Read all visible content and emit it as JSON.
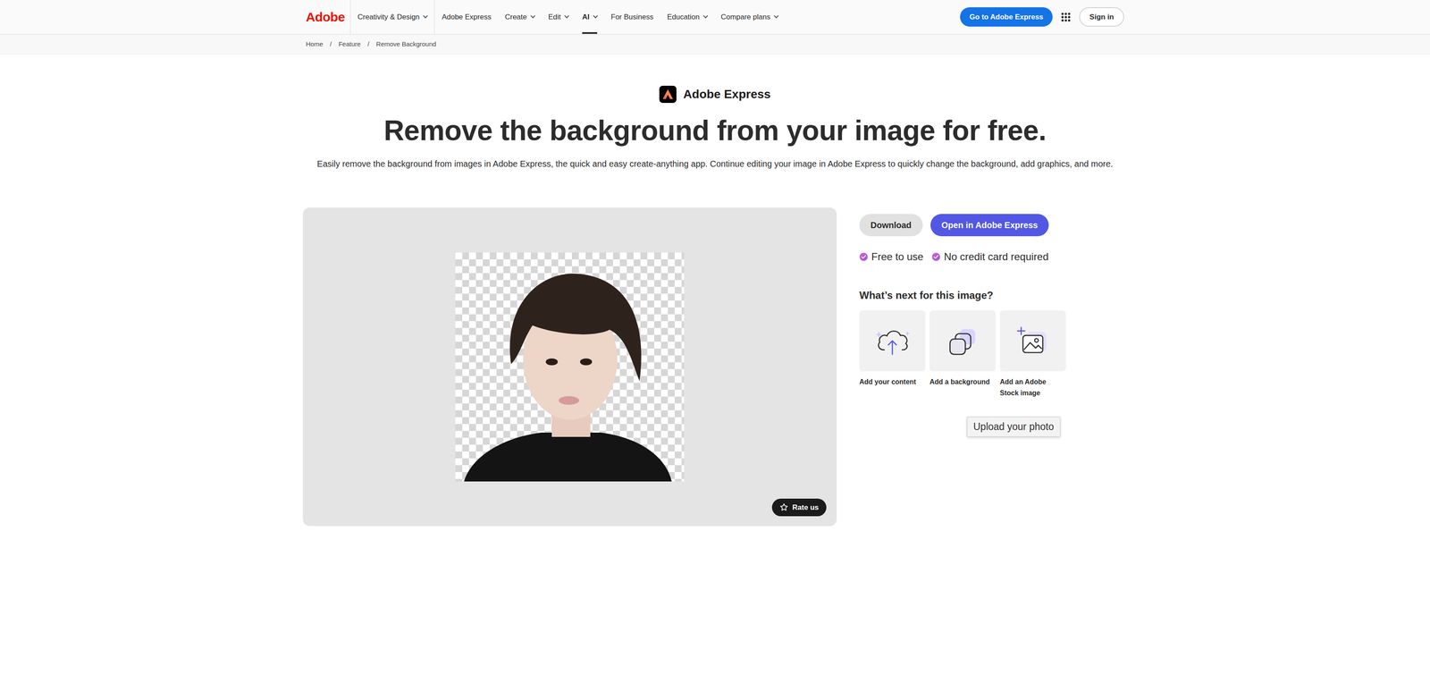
{
  "nav": {
    "logo": "Adobe",
    "items": [
      {
        "label": "Creativity & Design",
        "dropdown": true,
        "selected": false
      },
      {
        "label": "Adobe Express",
        "dropdown": false,
        "selected": false
      },
      {
        "label": "Create",
        "dropdown": true,
        "selected": false
      },
      {
        "label": "Edit",
        "dropdown": true,
        "selected": false
      },
      {
        "label": "AI",
        "dropdown": true,
        "selected": true
      },
      {
        "label": "For Business",
        "dropdown": false,
        "selected": false
      },
      {
        "label": "Education",
        "dropdown": true,
        "selected": false
      },
      {
        "label": "Compare plans",
        "dropdown": true,
        "selected": false
      }
    ],
    "cta": "Go to Adobe Express",
    "sign_in": "Sign in"
  },
  "breadcrumb": {
    "separator": "/",
    "items": [
      "Home",
      "Feature",
      "Remove Background"
    ]
  },
  "brand": "Adobe Express",
  "title": "Remove the background from your image for free.",
  "subtitle": "Easily remove the background from images in Adobe Express, the quick and easy create-anything app. Continue editing your image in Adobe Express to quickly change the background, add graphics, and more.",
  "preview": {
    "rate": "Rate us"
  },
  "actions": [
    {
      "label": "Download",
      "kind": "secondary"
    },
    {
      "label": "Open in Adobe Express",
      "kind": "primary"
    }
  ],
  "perks": [
    "Free to use",
    "No credit card required"
  ],
  "next": {
    "heading": "What’s next for this image?",
    "options": [
      {
        "label": "Add your content",
        "kind": "upload"
      },
      {
        "label": "Add a background",
        "kind": "layers"
      },
      {
        "label": "Add an Adobe Stock image",
        "kind": "stock"
      }
    ]
  },
  "tooltip": "Upload your photo"
}
